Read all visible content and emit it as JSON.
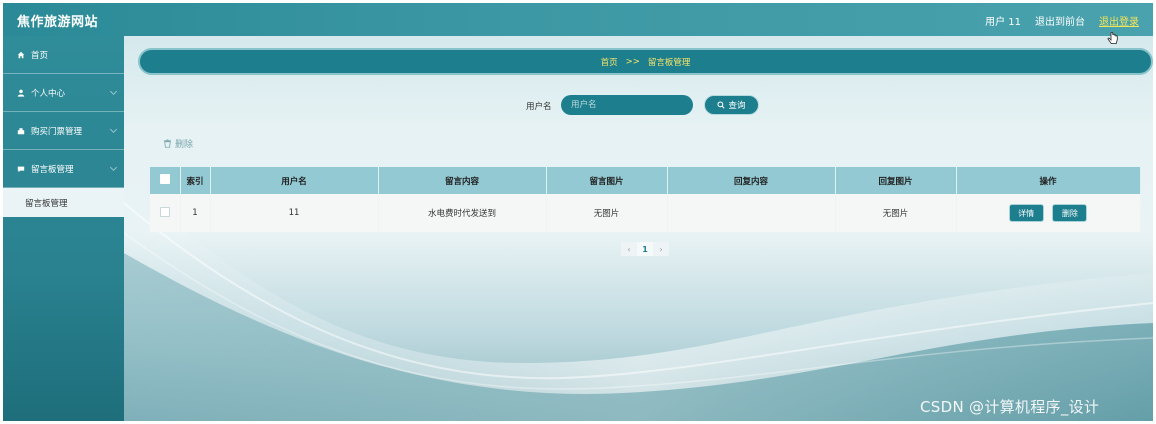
{
  "header": {
    "site_title": "焦作旅游网站",
    "user_label": "用户 11",
    "back_label": "退出到前台",
    "logout_label": "退出登录"
  },
  "sidebar": {
    "items": [
      {
        "label": "首页",
        "icon": "home-icon"
      },
      {
        "label": "个人中心",
        "icon": "user-icon"
      },
      {
        "label": "购买门票管理",
        "icon": "ticket-icon"
      },
      {
        "label": "留言板管理",
        "icon": "message-icon"
      }
    ],
    "active_sub": "留言板管理"
  },
  "breadcrumb": {
    "home": "首页",
    "sep": ">>",
    "current": "留言板管理"
  },
  "search": {
    "label": "用户名",
    "placeholder": "用户名",
    "button": "查询"
  },
  "toolbar": {
    "delete_label": "删除"
  },
  "table": {
    "headers": [
      "索引",
      "用户名",
      "留言内容",
      "留言图片",
      "回复内容",
      "回复图片",
      "操作"
    ],
    "rows": [
      {
        "index": "1",
        "username": "11",
        "content": "水电费时代发送到",
        "image": "无图片",
        "reply": "",
        "reply_image": "无图片"
      }
    ],
    "detail_label": "详情",
    "delete_label": "删除"
  },
  "pagination": {
    "prev": "‹",
    "current": "1",
    "next": "›"
  },
  "watermark": "CSDN @计算机程序_设计",
  "colors": {
    "primary": "#1d7f8d",
    "header": "#2b8a97",
    "accent": "#f3e45a"
  }
}
